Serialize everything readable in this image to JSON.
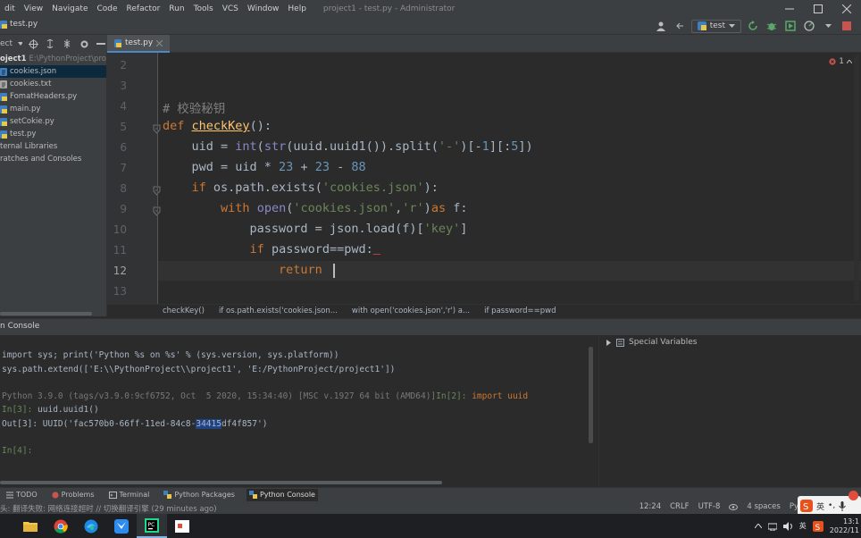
{
  "menubar": {
    "items": [
      "dit",
      "View",
      "Navigate",
      "Code",
      "Refactor",
      "Run",
      "Tools",
      "VCS",
      "Window",
      "Help"
    ],
    "window_title": "project1 - test.py - Administrator"
  },
  "navbar": {
    "file_label": "test.py",
    "run_config": "test"
  },
  "project_header": {
    "label": "ect"
  },
  "editor_tab": {
    "label": "test.py"
  },
  "project_tree": {
    "items": [
      {
        "label": "oject1",
        "detail": "E:\\PythonProject\\proj",
        "bold": true
      },
      {
        "label": "cookies.json",
        "selected": true
      },
      {
        "label": "cookies.txt"
      },
      {
        "label": "FomatHeaders.py"
      },
      {
        "label": "main.py"
      },
      {
        "label": "setCokie.py"
      },
      {
        "label": "test.py"
      },
      {
        "label": "ternal Libraries"
      },
      {
        "label": "ratches and Consoles"
      }
    ]
  },
  "editor": {
    "error_count": "1",
    "line_numbers": [
      "2",
      "3",
      "4",
      "5",
      "6",
      "7",
      "8",
      "9",
      "10",
      "11",
      "12",
      "13"
    ],
    "current_line": "12"
  },
  "breadcrumbs": [
    "checkKey()",
    "if os.path.exists('cookies.json...",
    "with open('cookies.json','r') a...",
    "if password==pwd"
  ],
  "console": {
    "title": "n Console",
    "lines": {
      "l1": "import sys; print('Python %s on %s' % (sys.version, sys.platform))",
      "l2": "sys.path.extend(['E:\\\\PythonProject\\\\project1', 'E:/PythonProject/project1'])",
      "l3": "Python 3.9.0 (tags/v3.9.0:9cf6752, Oct  5 2020, 15:34:40) [MSC v.1927 64 bit (AMD64)]",
      "l3_prompt": "In[2]:",
      "l3_cmd": " import uuid",
      "l4_prompt": "In[3]:",
      "l4_cmd": " uuid.uuid1()",
      "l5_pre": "Out[3]: UUID('fac570b0-66ff-11ed-84c8-",
      "l5_hl": "34415",
      "l5_post": "df4f857')",
      "l6_prompt": "In[4]:"
    },
    "variables_title": "Special Variables"
  },
  "toolwindows": [
    "TODO",
    "Problems",
    "Terminal",
    "Python Packages",
    "Python Console"
  ],
  "status": {
    "message": "头: 翻译失败: 网络连接超时 // 切换翻译引擎 (29 minutes ago)",
    "position": "12:24",
    "line_sep": "CRLF",
    "encoding": "UTF-8",
    "indent": "4 spaces",
    "interpreter": "Py"
  },
  "ime": {
    "lang": "英",
    "punct": "•,"
  },
  "tray": {
    "lang": "英",
    "time": "13:1",
    "date": "2022/11"
  },
  "colors": {
    "editor_bg": "#2b2b2b",
    "panel_bg": "#3c3f41",
    "keyword": "#cc7832",
    "string": "#6a8759",
    "number": "#6897bb",
    "function": "#ffc66d",
    "accent": "#4a88c7"
  }
}
